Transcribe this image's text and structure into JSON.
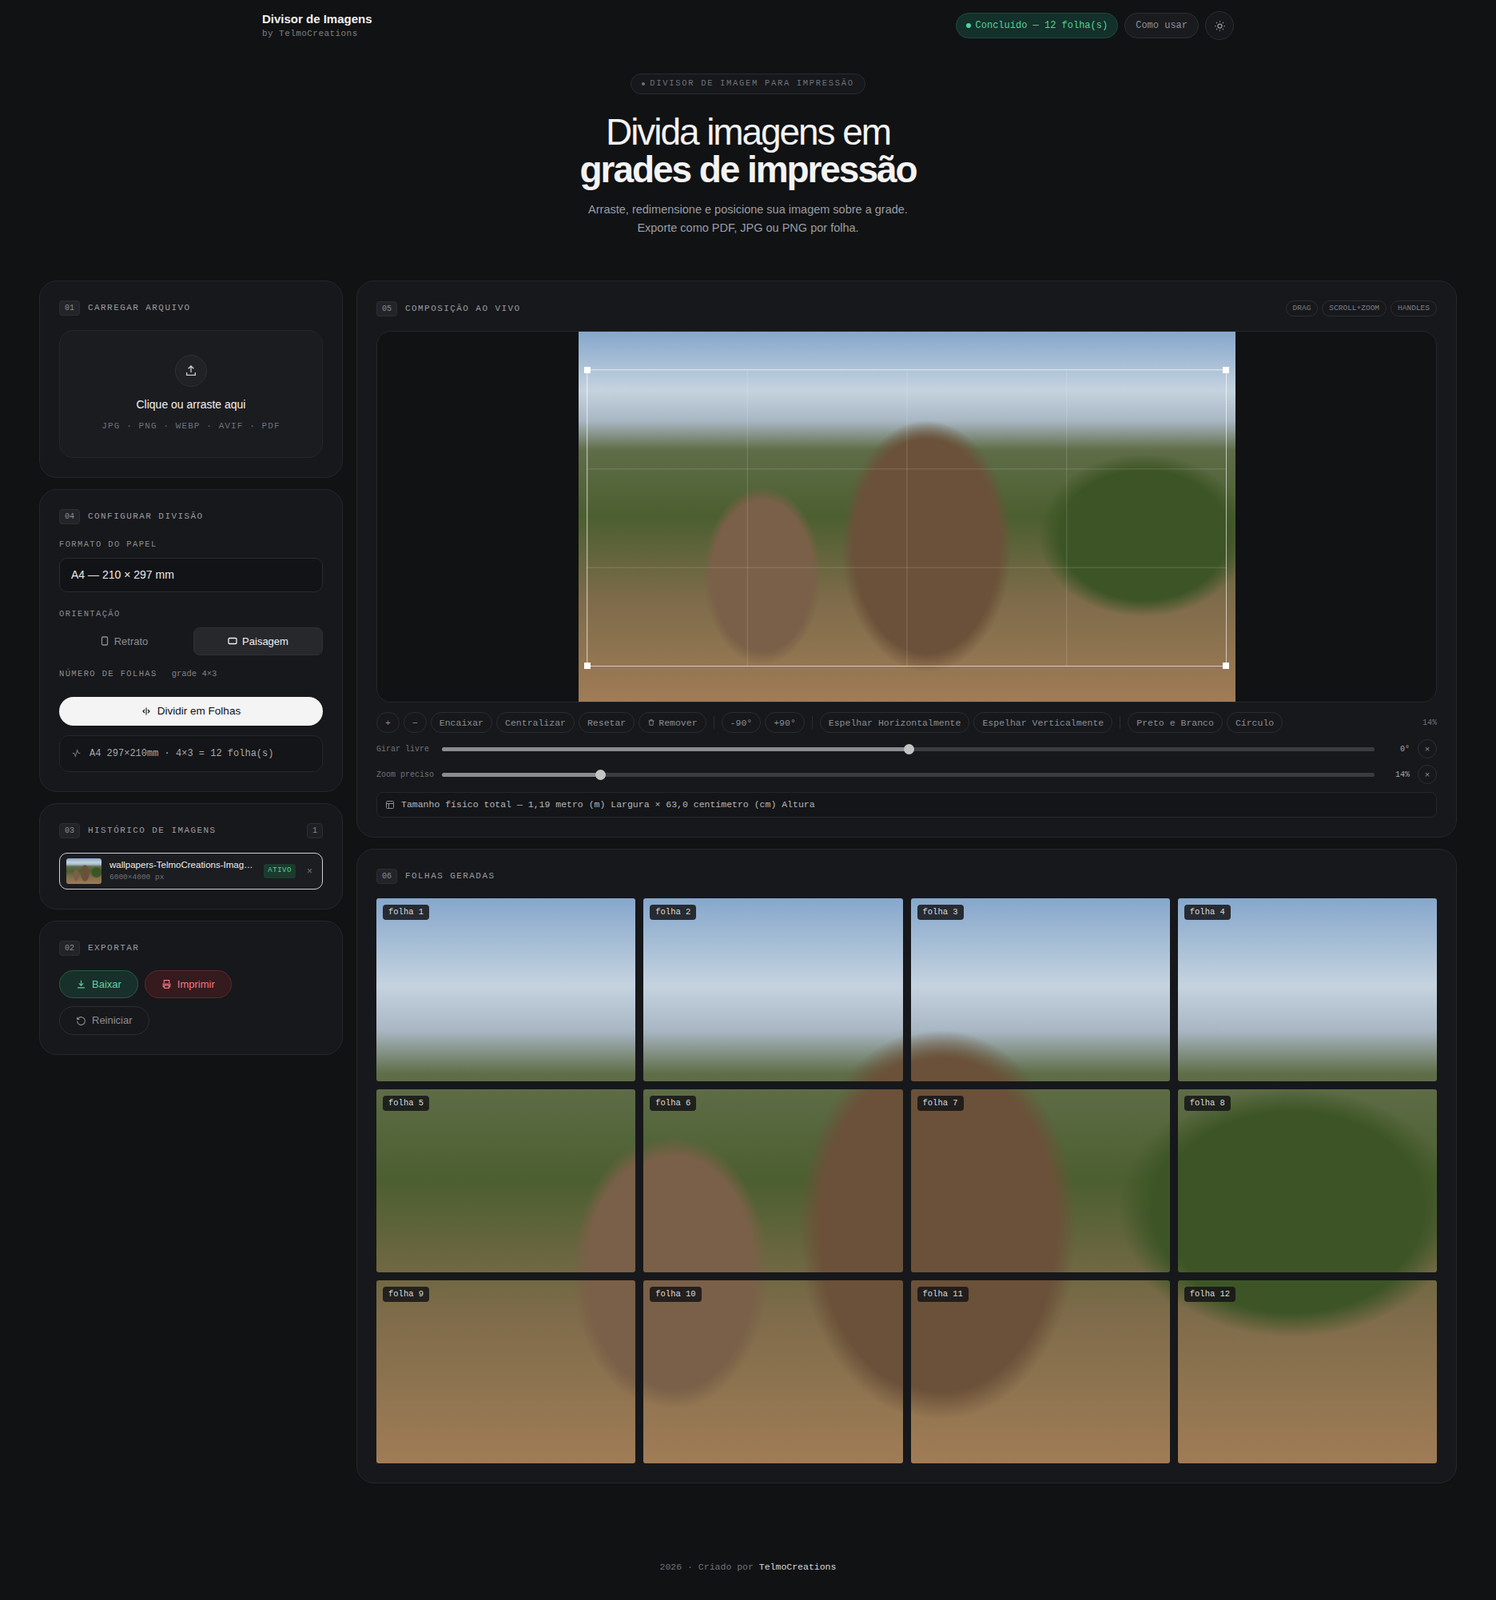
{
  "app": {
    "title": "Divisor de Imagens",
    "byline": "by TelmoCreations"
  },
  "header": {
    "status": "Concluído — 12 folha(s)",
    "help": "Como usar"
  },
  "hero": {
    "eyebrow": "DIVISOR DE IMAGEM PARA IMPRESSÃO",
    "title_line1": "Divida imagens em",
    "title_line2": "grades de impressão",
    "subtitle_line1": "Arraste, redimensione e posicione sua imagem sobre a grade.",
    "subtitle_line2": "Exporte como PDF, JPG ou PNG por folha."
  },
  "upload": {
    "number": "01",
    "title": "CARREGAR ARQUIVO",
    "prompt": "Clique ou arraste aqui",
    "formats": "JPG · PNG · WEBP · AVIF · PDF"
  },
  "config": {
    "number": "04",
    "title": "CONFIGURAR DIVISÃO",
    "paper_label": "FORMATO DO PAPEL",
    "paper_value": "A4 — 210 × 297 mm",
    "orientation_label": "ORIENTAÇÃO",
    "orientations": [
      {
        "label": "Retrato",
        "kind": "portrait",
        "selected": false
      },
      {
        "label": "Paisagem",
        "kind": "landscape",
        "selected": true
      }
    ],
    "sheets_label": "NÚMERO DE FOLHAS",
    "sheets_value": "grade 4×3",
    "divide_button": "Dividir em Folhas",
    "summary": "A4 297×210mm · 4×3 = 12 folha(s)"
  },
  "history": {
    "number": "03",
    "title": "HISTÓRICO DE IMAGENS",
    "count": "1",
    "items": [
      {
        "name": "wallpapers-TelmoCreations-Imag…",
        "size": "6000×4000 px",
        "badge": "ATIVO",
        "remove": "×",
        "selected": true
      }
    ]
  },
  "export": {
    "number": "02",
    "title": "EXPORTAR",
    "download": "Baixar",
    "print": "Imprimir",
    "reset": "Reiniciar"
  },
  "composer": {
    "number": "05",
    "title": "COMPOSIÇÃO AO VIVO",
    "hints": [
      "DRAG",
      "SCROLL+ZOOM",
      "HANDLES"
    ],
    "tool_groups": [
      [
        {
          "label": "+",
          "kind": "plain"
        },
        {
          "label": "−",
          "kind": "plain"
        },
        {
          "label": "Encaixar",
          "kind": "plain"
        },
        {
          "label": "Centralizar",
          "kind": "plain"
        },
        {
          "label": "Resetar",
          "kind": "plain"
        },
        {
          "label": "Remover",
          "kind": "trash"
        }
      ],
      [
        {
          "label": "-90°",
          "kind": "plain"
        },
        {
          "label": "+90°",
          "kind": "plain"
        }
      ],
      [
        {
          "label": "Espelhar Horizontalmente",
          "kind": "plain"
        },
        {
          "label": "Espelhar Verticalmente",
          "kind": "plain"
        }
      ],
      [
        {
          "label": "Preto e Branco",
          "kind": "plain"
        },
        {
          "label": "Círculo",
          "kind": "plain"
        }
      ]
    ],
    "zoom_readout": "14%",
    "sliders": [
      {
        "label": "Girar livre",
        "level": 0.5,
        "reading": "0°",
        "reset": "×"
      },
      {
        "label": "Zoom preciso",
        "level": 0.17,
        "reading": "14%",
        "reset": "×"
      }
    ],
    "size_info": "Tamanho físico total — 1,19 metro (m) Largura × 63,0 centímetro (cm) Altura"
  },
  "sheets": {
    "number": "06",
    "title": "FOLHAS GERADAS",
    "items": [
      {
        "label": "folha 1"
      },
      {
        "label": "folha 2"
      },
      {
        "label": "folha 3"
      },
      {
        "label": "folha 4"
      },
      {
        "label": "folha 5"
      },
      {
        "label": "folha 6"
      },
      {
        "label": "folha 7"
      },
      {
        "label": "folha 8"
      },
      {
        "label": "folha 9"
      },
      {
        "label": "folha 10"
      },
      {
        "label": "folha 11"
      },
      {
        "label": "folha 12"
      }
    ]
  },
  "footer": {
    "prefix": "2026 · Criado por",
    "brand": "TelmoCreations"
  }
}
